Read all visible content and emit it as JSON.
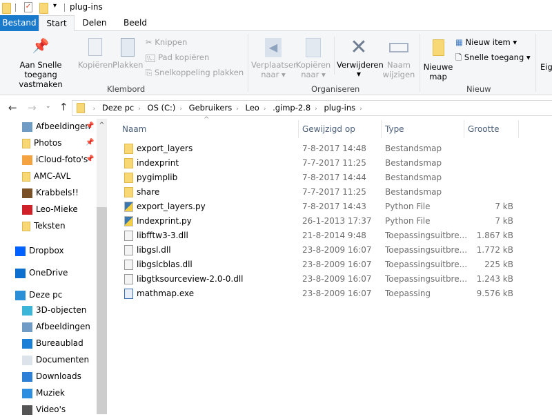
{
  "title": "plug-ins",
  "tabs": [
    "Bestand",
    "Start",
    "Delen",
    "Beeld"
  ],
  "ribbon": {
    "pin": [
      "Aan Snelle toegang",
      "vastmaken"
    ],
    "copy": "Kopiëren",
    "paste": "Plakken",
    "cut": "Knippen",
    "copy_path": "Pad kopiëren",
    "paste_shortcut": "Snelkoppeling plakken",
    "group_clipboard": "Klembord",
    "move_to": [
      "Verplaatsen",
      "naar"
    ],
    "copy_to": [
      "Kopiëren",
      "naar"
    ],
    "delete": "Verwijderen",
    "rename": [
      "Naam",
      "wijzigen"
    ],
    "group_organize": "Organiseren",
    "new_folder": [
      "Nieuwe",
      "map"
    ],
    "new_item": "Nieuw item",
    "easy_access": "Snelle toegang",
    "group_new": "Nieuw",
    "properties": "Eig"
  },
  "address": {
    "crumbs": [
      "Deze pc",
      "OS (C:)",
      "Gebruikers",
      "Leo",
      ".gimp-2.8",
      "plug-ins"
    ]
  },
  "nav": [
    {
      "label": "Afbeeldingen",
      "icon": "pictures-icon",
      "pinned": true
    },
    {
      "label": "Photos",
      "icon": "folder-icon",
      "pinned": true
    },
    {
      "label": "iCloud-foto's",
      "icon": "icloud-photos-icon",
      "pinned": true
    },
    {
      "label": "AMC-AVL",
      "icon": "folder-icon"
    },
    {
      "label": "Krabbels!!",
      "icon": "contacts-book-icon"
    },
    {
      "label": "Leo-Mieke",
      "icon": "rose-icon"
    },
    {
      "label": "Teksten",
      "icon": "folder-icon"
    },
    {
      "label": "Dropbox",
      "icon": "dropbox-icon"
    },
    {
      "label": "OneDrive",
      "icon": "onedrive-icon"
    },
    {
      "label": "Deze pc",
      "icon": "computer-icon"
    },
    {
      "label": "3D-objecten",
      "icon": "3d-objects-icon"
    },
    {
      "label": "Afbeeldingen",
      "icon": "pictures-icon"
    },
    {
      "label": "Bureaublad",
      "icon": "desktop-icon"
    },
    {
      "label": "Documenten",
      "icon": "documents-icon"
    },
    {
      "label": "Downloads",
      "icon": "downloads-icon"
    },
    {
      "label": "Muziek",
      "icon": "music-icon"
    },
    {
      "label": "Video's",
      "icon": "videos-icon"
    }
  ],
  "columns": [
    "Naam",
    "Gewijzigd op",
    "Type",
    "Grootte"
  ],
  "files": [
    {
      "name": "export_layers",
      "date": "7-8-2017 14:48",
      "type": "Bestandsmap",
      "size": "",
      "kind": "folder"
    },
    {
      "name": "indexprint",
      "date": "7-7-2017 11:25",
      "type": "Bestandsmap",
      "size": "",
      "kind": "folder"
    },
    {
      "name": "pygimplib",
      "date": "7-8-2017 14:44",
      "type": "Bestandsmap",
      "size": "",
      "kind": "folder"
    },
    {
      "name": "share",
      "date": "7-7-2017 11:25",
      "type": "Bestandsmap",
      "size": "",
      "kind": "folder"
    },
    {
      "name": "export_layers.py",
      "date": "7-8-2017 14:43",
      "type": "Python File",
      "size": "7 kB",
      "kind": "py"
    },
    {
      "name": "Indexprint.py",
      "date": "26-1-2013 17:37",
      "type": "Python File",
      "size": "7 kB",
      "kind": "py"
    },
    {
      "name": "libfftw3-3.dll",
      "date": "21-8-2014 9:48",
      "type": "Toepassingsuitbre...",
      "size": "1.867 kB",
      "kind": "dll"
    },
    {
      "name": "libgsl.dll",
      "date": "23-8-2009 16:07",
      "type": "Toepassingsuitbre...",
      "size": "1.772 kB",
      "kind": "dll"
    },
    {
      "name": "libgslcblas.dll",
      "date": "23-8-2009 16:07",
      "type": "Toepassingsuitbre...",
      "size": "225 kB",
      "kind": "dll"
    },
    {
      "name": "libgtksourceview-2.0-0.dll",
      "date": "23-8-2009 16:07",
      "type": "Toepassingsuitbre...",
      "size": "1.243 kB",
      "kind": "dll"
    },
    {
      "name": "mathmap.exe",
      "date": "23-8-2009 16:07",
      "type": "Toepassing",
      "size": "9.576 kB",
      "kind": "exe"
    }
  ]
}
